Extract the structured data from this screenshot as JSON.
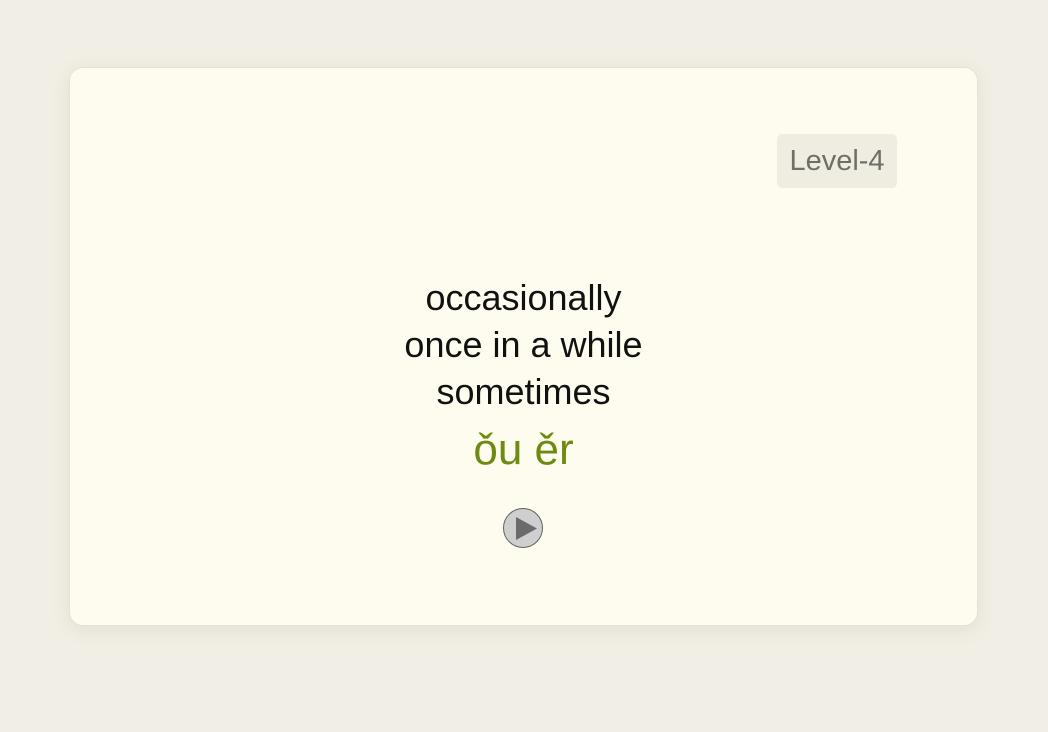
{
  "card": {
    "level": "Level-4",
    "meanings": [
      "occasionally",
      "once in a while",
      "sometimes"
    ],
    "pinyin": "ǒu ěr",
    "play_icon": "play-icon"
  },
  "colors": {
    "background": "#f1efe5",
    "card": "#fefcef",
    "pinyin": "#6e8a10",
    "badge_bg": "#efede1",
    "badge_text": "#6f6f6a"
  }
}
